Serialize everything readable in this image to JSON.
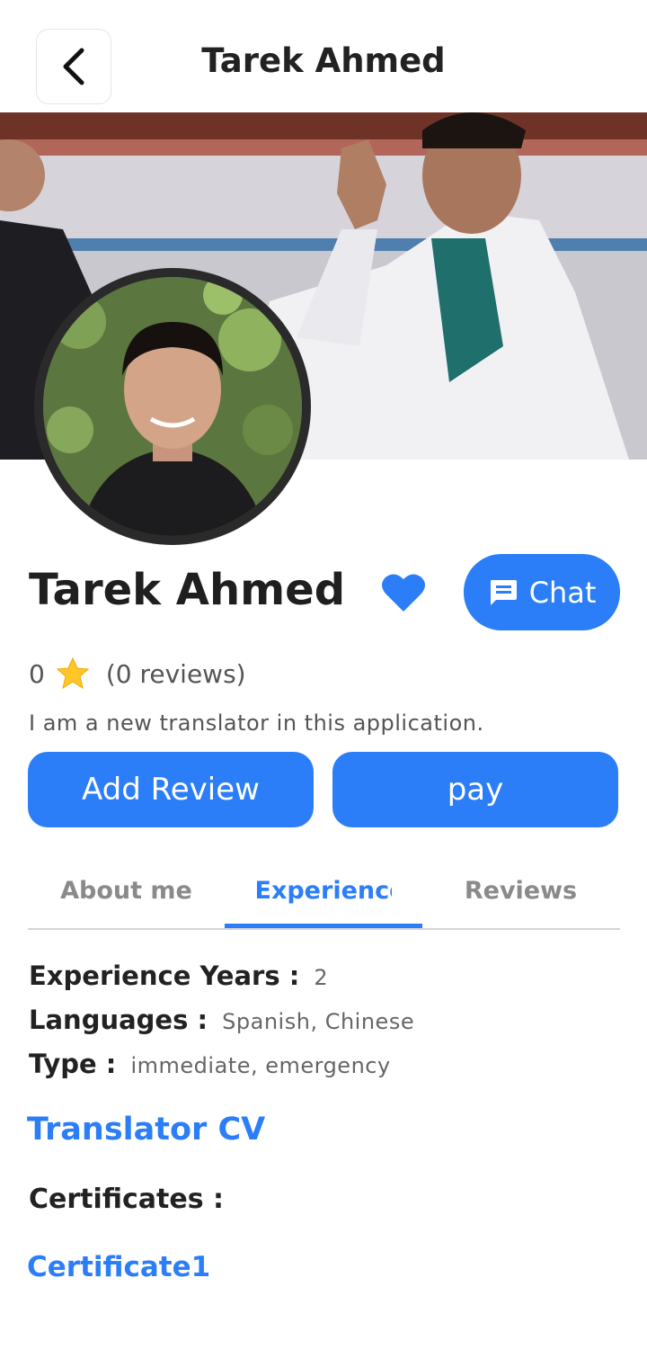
{
  "header": {
    "title": "Tarek Ahmed",
    "back_icon": "chevron-left-icon"
  },
  "profile": {
    "name": "Tarek Ahmed",
    "rating_value": "0",
    "reviews_text": "(0 reviews)",
    "bio": "I am a new translator in this application.",
    "favorite": true
  },
  "actions": {
    "chat_label": "Chat",
    "add_review_label": "Add Review",
    "pay_label": "pay"
  },
  "tabs": [
    {
      "label": "About me",
      "active": false
    },
    {
      "label": "Experience",
      "active": true
    },
    {
      "label": "Reviews",
      "active": false
    }
  ],
  "experience": {
    "years_label": "Experience Years :",
    "years_value": "2",
    "languages_label": "Languages :",
    "languages_value": "Spanish, Chinese",
    "type_label": "Type :",
    "type_value": "immediate, emergency",
    "cv_link": "Translator CV",
    "certificates_label": "Certificates :",
    "certificate_link": "Certificate1"
  },
  "colors": {
    "accent": "#2b7ef7",
    "text": "#1f1f1f",
    "muted": "#8a8a8a"
  }
}
